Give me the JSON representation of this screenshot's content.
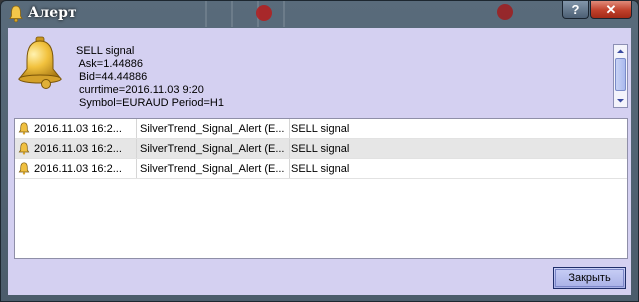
{
  "window": {
    "title": "Алерт",
    "help_label": "?",
    "close_label": "✕"
  },
  "message": {
    "text": "SELL signal\n Ask=1.44886\n Bid=44.44886\n currtime=2016.11.03 9:20\n Symbol=EURAUD Period=H1"
  },
  "alerts": [
    {
      "time": "2016.11.03 16:2...",
      "source": "SilverTrend_Signal_Alert (E...",
      "message": "SELL signal"
    },
    {
      "time": "2016.11.03 16:2...",
      "source": "SilverTrend_Signal_Alert (E...",
      "message": "SELL signal"
    },
    {
      "time": "2016.11.03 16:2...",
      "source": "SilverTrend_Signal_Alert (E...",
      "message": "SELL signal"
    }
  ],
  "buttons": {
    "close_label": "Закрыть"
  },
  "colors": {
    "client_bg": "#d4d0f1",
    "title_bar": "#596b7b",
    "close_red": "#c0402b",
    "selected_row": "#e6e6e6",
    "bell_gold": "#e8b832"
  },
  "icons": {
    "title": "bell-icon",
    "message": "bell-icon",
    "row": "bell-icon"
  }
}
